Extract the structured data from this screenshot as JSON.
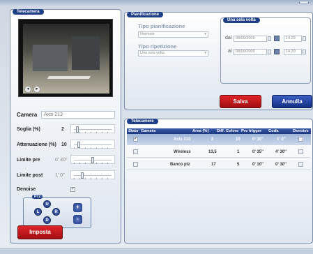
{
  "camera_panel": {
    "title": "Telecamera",
    "camera_label": "Camera",
    "camera_value": "Axis 213",
    "soglia_label": "Soglia (%)",
    "soglia_value": "2",
    "soglia_level": 0.05,
    "attenuazione_label": "Attenuazione (%)",
    "attenuazione_value": "10",
    "attenuazione_level": 0.1,
    "limite_pre_label": "Limite pre",
    "limite_pre_value": "0' 30''",
    "limite_pre_level": 0.5,
    "limite_post_label": "Limite post",
    "limite_post_value": "1' 0''",
    "limite_post_level": 0.2,
    "denoise_label": "Denoise",
    "denoise_checked": true,
    "ptz_label": "PTZ",
    "ptz_up": "U",
    "ptz_left": "L",
    "ptz_right": "R",
    "ptz_down": "D",
    "zoom_in": "+",
    "zoom_out": "-",
    "apply_button": "Imposta"
  },
  "planning_panel": {
    "title": "Pianificazione",
    "tipo_pianificazione_label": "Tipo pianificazione",
    "tipo_pianificazione_value": "Normale",
    "tipo_ripetizione_label": "Tipo ripetizione",
    "tipo_ripetizione_value": "Una sola volta",
    "once": {
      "title": "Una sola volta",
      "dal_label": "dal",
      "dal_date": "08/09/2009",
      "dal_time": "14.29",
      "al_label": "al",
      "al_date": "08/09/2009",
      "al_time": "14.29"
    },
    "save_button": "Salva",
    "cancel_button": "Annulla"
  },
  "cameras_table": {
    "title": "Telecamere",
    "columns": [
      "Stato",
      "Camera",
      "Area (%)",
      "Diff. Colore",
      "Pre trigger",
      "Coda",
      "Denoise"
    ],
    "rows": [
      {
        "camera": "Axis 213",
        "area": "2",
        "diff": "10",
        "pre": "0' 30''",
        "coda": "1' 0''",
        "selected": true
      },
      {
        "camera": "Wireless",
        "area": "13,5",
        "diff": "1",
        "pre": "0' 35''",
        "coda": "4' 30''",
        "selected": false
      },
      {
        "camera": "Banco ptz",
        "area": "17",
        "diff": "5",
        "pre": "0' 10''",
        "coda": "0' 30''",
        "selected": false
      }
    ]
  },
  "colors": {
    "title_bg": "#1f3f86",
    "apply_button": "#c4161b",
    "cancel_button": "#1e3a8a",
    "table_header": "#2a4a96"
  }
}
